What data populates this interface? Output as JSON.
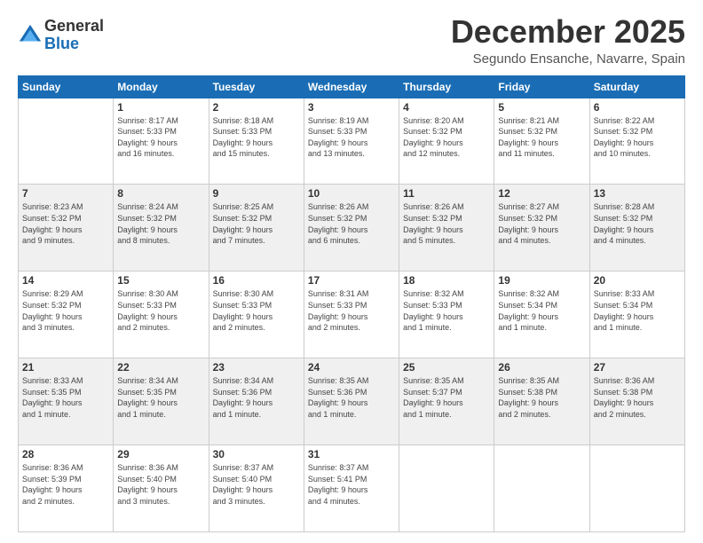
{
  "logo": {
    "general": "General",
    "blue": "Blue"
  },
  "title": {
    "month": "December 2025",
    "location": "Segundo Ensanche, Navarre, Spain"
  },
  "headers": [
    "Sunday",
    "Monday",
    "Tuesday",
    "Wednesday",
    "Thursday",
    "Friday",
    "Saturday"
  ],
  "weeks": [
    [
      {
        "day": "",
        "info": ""
      },
      {
        "day": "1",
        "info": "Sunrise: 8:17 AM\nSunset: 5:33 PM\nDaylight: 9 hours\nand 16 minutes."
      },
      {
        "day": "2",
        "info": "Sunrise: 8:18 AM\nSunset: 5:33 PM\nDaylight: 9 hours\nand 15 minutes."
      },
      {
        "day": "3",
        "info": "Sunrise: 8:19 AM\nSunset: 5:33 PM\nDaylight: 9 hours\nand 13 minutes."
      },
      {
        "day": "4",
        "info": "Sunrise: 8:20 AM\nSunset: 5:32 PM\nDaylight: 9 hours\nand 12 minutes."
      },
      {
        "day": "5",
        "info": "Sunrise: 8:21 AM\nSunset: 5:32 PM\nDaylight: 9 hours\nand 11 minutes."
      },
      {
        "day": "6",
        "info": "Sunrise: 8:22 AM\nSunset: 5:32 PM\nDaylight: 9 hours\nand 10 minutes."
      }
    ],
    [
      {
        "day": "7",
        "info": "Sunrise: 8:23 AM\nSunset: 5:32 PM\nDaylight: 9 hours\nand 9 minutes."
      },
      {
        "day": "8",
        "info": "Sunrise: 8:24 AM\nSunset: 5:32 PM\nDaylight: 9 hours\nand 8 minutes."
      },
      {
        "day": "9",
        "info": "Sunrise: 8:25 AM\nSunset: 5:32 PM\nDaylight: 9 hours\nand 7 minutes."
      },
      {
        "day": "10",
        "info": "Sunrise: 8:26 AM\nSunset: 5:32 PM\nDaylight: 9 hours\nand 6 minutes."
      },
      {
        "day": "11",
        "info": "Sunrise: 8:26 AM\nSunset: 5:32 PM\nDaylight: 9 hours\nand 5 minutes."
      },
      {
        "day": "12",
        "info": "Sunrise: 8:27 AM\nSunset: 5:32 PM\nDaylight: 9 hours\nand 4 minutes."
      },
      {
        "day": "13",
        "info": "Sunrise: 8:28 AM\nSunset: 5:32 PM\nDaylight: 9 hours\nand 4 minutes."
      }
    ],
    [
      {
        "day": "14",
        "info": "Sunrise: 8:29 AM\nSunset: 5:32 PM\nDaylight: 9 hours\nand 3 minutes."
      },
      {
        "day": "15",
        "info": "Sunrise: 8:30 AM\nSunset: 5:33 PM\nDaylight: 9 hours\nand 2 minutes."
      },
      {
        "day": "16",
        "info": "Sunrise: 8:30 AM\nSunset: 5:33 PM\nDaylight: 9 hours\nand 2 minutes."
      },
      {
        "day": "17",
        "info": "Sunrise: 8:31 AM\nSunset: 5:33 PM\nDaylight: 9 hours\nand 2 minutes."
      },
      {
        "day": "18",
        "info": "Sunrise: 8:32 AM\nSunset: 5:33 PM\nDaylight: 9 hours\nand 1 minute."
      },
      {
        "day": "19",
        "info": "Sunrise: 8:32 AM\nSunset: 5:34 PM\nDaylight: 9 hours\nand 1 minute."
      },
      {
        "day": "20",
        "info": "Sunrise: 8:33 AM\nSunset: 5:34 PM\nDaylight: 9 hours\nand 1 minute."
      }
    ],
    [
      {
        "day": "21",
        "info": "Sunrise: 8:33 AM\nSunset: 5:35 PM\nDaylight: 9 hours\nand 1 minute."
      },
      {
        "day": "22",
        "info": "Sunrise: 8:34 AM\nSunset: 5:35 PM\nDaylight: 9 hours\nand 1 minute."
      },
      {
        "day": "23",
        "info": "Sunrise: 8:34 AM\nSunset: 5:36 PM\nDaylight: 9 hours\nand 1 minute."
      },
      {
        "day": "24",
        "info": "Sunrise: 8:35 AM\nSunset: 5:36 PM\nDaylight: 9 hours\nand 1 minute."
      },
      {
        "day": "25",
        "info": "Sunrise: 8:35 AM\nSunset: 5:37 PM\nDaylight: 9 hours\nand 1 minute."
      },
      {
        "day": "26",
        "info": "Sunrise: 8:35 AM\nSunset: 5:38 PM\nDaylight: 9 hours\nand 2 minutes."
      },
      {
        "day": "27",
        "info": "Sunrise: 8:36 AM\nSunset: 5:38 PM\nDaylight: 9 hours\nand 2 minutes."
      }
    ],
    [
      {
        "day": "28",
        "info": "Sunrise: 8:36 AM\nSunset: 5:39 PM\nDaylight: 9 hours\nand 2 minutes."
      },
      {
        "day": "29",
        "info": "Sunrise: 8:36 AM\nSunset: 5:40 PM\nDaylight: 9 hours\nand 3 minutes."
      },
      {
        "day": "30",
        "info": "Sunrise: 8:37 AM\nSunset: 5:40 PM\nDaylight: 9 hours\nand 3 minutes."
      },
      {
        "day": "31",
        "info": "Sunrise: 8:37 AM\nSunset: 5:41 PM\nDaylight: 9 hours\nand 4 minutes."
      },
      {
        "day": "",
        "info": ""
      },
      {
        "day": "",
        "info": ""
      },
      {
        "day": "",
        "info": ""
      }
    ]
  ],
  "row_shading": [
    false,
    true,
    false,
    true,
    false
  ]
}
